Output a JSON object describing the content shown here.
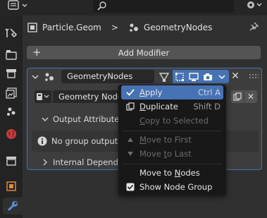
{
  "header": {
    "search_placeholder": "",
    "icons": [
      "editor-type-icon",
      "search-icon",
      "options-icon"
    ]
  },
  "tabs": [
    "tool-icon",
    "render-icon",
    "output-icon",
    "view-layer-icon",
    "scene-icon",
    "world-icon",
    "collection-icon",
    "object-icon",
    "modifier-icon"
  ],
  "breadcrumb": {
    "object": "Particle.Geom",
    "separator": ">",
    "modifier": "GeometryNodes"
  },
  "add_modifier": {
    "label": "Add Modifier"
  },
  "modifier": {
    "name": "GeometryNodes",
    "node_group": "Geometry Nodes",
    "output_attributes_label": "Output Attributes",
    "warning_text": "No group output a",
    "internal_dependencies_label": "Internal Dependen",
    "close_label": "✕"
  },
  "menu": {
    "items": [
      {
        "label_pre": "",
        "label_ul": "A",
        "label_post": "pply",
        "shortcut": "Ctrl A",
        "icon": "check-icon",
        "enabled": true,
        "highlighted": true
      },
      {
        "label_pre": "",
        "label_ul": "D",
        "label_post": "uplicate",
        "shortcut": "Shift D",
        "icon": "duplicate-icon",
        "enabled": true
      },
      {
        "label_pre": "",
        "label_ul": "C",
        "label_post": "opy to Selected",
        "shortcut": "",
        "icon": "",
        "enabled": false
      },
      {
        "label_pre": "",
        "label_ul": "M",
        "label_post": "ove to First",
        "shortcut": "",
        "icon": "triangle-up-icon",
        "enabled": false
      },
      {
        "label_pre": "Move ",
        "label_ul": "t",
        "label_post": "o Last",
        "shortcut": "",
        "icon": "triangle-down-icon",
        "enabled": false
      },
      {
        "label_pre": "Move to ",
        "label_ul": "N",
        "label_post": "odes",
        "shortcut": "",
        "icon": "",
        "enabled": true
      },
      {
        "label_pre": "Show Node Group",
        "label_ul": "",
        "label_post": "",
        "shortcut": "",
        "icon": "checkbox-checked-icon",
        "enabled": true
      }
    ]
  },
  "colors": {
    "accent": "#4772b3",
    "background": "#303030",
    "menu_bg": "#181818"
  }
}
